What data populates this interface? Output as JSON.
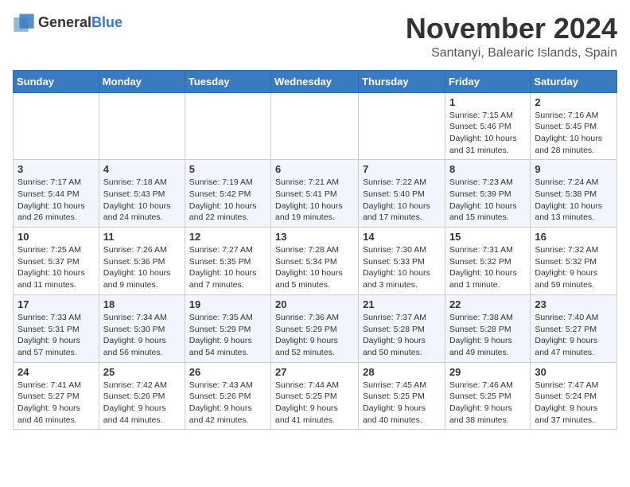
{
  "logo": {
    "general": "General",
    "blue": "Blue"
  },
  "header": {
    "month": "November 2024",
    "location": "Santanyi, Balearic Islands, Spain"
  },
  "weekdays": [
    "Sunday",
    "Monday",
    "Tuesday",
    "Wednesday",
    "Thursday",
    "Friday",
    "Saturday"
  ],
  "weeks": [
    [
      {
        "day": "",
        "info": ""
      },
      {
        "day": "",
        "info": ""
      },
      {
        "day": "",
        "info": ""
      },
      {
        "day": "",
        "info": ""
      },
      {
        "day": "",
        "info": ""
      },
      {
        "day": "1",
        "info": "Sunrise: 7:15 AM\nSunset: 5:46 PM\nDaylight: 10 hours and 31 minutes."
      },
      {
        "day": "2",
        "info": "Sunrise: 7:16 AM\nSunset: 5:45 PM\nDaylight: 10 hours and 28 minutes."
      }
    ],
    [
      {
        "day": "3",
        "info": "Sunrise: 7:17 AM\nSunset: 5:44 PM\nDaylight: 10 hours and 26 minutes."
      },
      {
        "day": "4",
        "info": "Sunrise: 7:18 AM\nSunset: 5:43 PM\nDaylight: 10 hours and 24 minutes."
      },
      {
        "day": "5",
        "info": "Sunrise: 7:19 AM\nSunset: 5:42 PM\nDaylight: 10 hours and 22 minutes."
      },
      {
        "day": "6",
        "info": "Sunrise: 7:21 AM\nSunset: 5:41 PM\nDaylight: 10 hours and 19 minutes."
      },
      {
        "day": "7",
        "info": "Sunrise: 7:22 AM\nSunset: 5:40 PM\nDaylight: 10 hours and 17 minutes."
      },
      {
        "day": "8",
        "info": "Sunrise: 7:23 AM\nSunset: 5:39 PM\nDaylight: 10 hours and 15 minutes."
      },
      {
        "day": "9",
        "info": "Sunrise: 7:24 AM\nSunset: 5:38 PM\nDaylight: 10 hours and 13 minutes."
      }
    ],
    [
      {
        "day": "10",
        "info": "Sunrise: 7:25 AM\nSunset: 5:37 PM\nDaylight: 10 hours and 11 minutes."
      },
      {
        "day": "11",
        "info": "Sunrise: 7:26 AM\nSunset: 5:36 PM\nDaylight: 10 hours and 9 minutes."
      },
      {
        "day": "12",
        "info": "Sunrise: 7:27 AM\nSunset: 5:35 PM\nDaylight: 10 hours and 7 minutes."
      },
      {
        "day": "13",
        "info": "Sunrise: 7:28 AM\nSunset: 5:34 PM\nDaylight: 10 hours and 5 minutes."
      },
      {
        "day": "14",
        "info": "Sunrise: 7:30 AM\nSunset: 5:33 PM\nDaylight: 10 hours and 3 minutes."
      },
      {
        "day": "15",
        "info": "Sunrise: 7:31 AM\nSunset: 5:32 PM\nDaylight: 10 hours and 1 minute."
      },
      {
        "day": "16",
        "info": "Sunrise: 7:32 AM\nSunset: 5:32 PM\nDaylight: 9 hours and 59 minutes."
      }
    ],
    [
      {
        "day": "17",
        "info": "Sunrise: 7:33 AM\nSunset: 5:31 PM\nDaylight: 9 hours and 57 minutes."
      },
      {
        "day": "18",
        "info": "Sunrise: 7:34 AM\nSunset: 5:30 PM\nDaylight: 9 hours and 56 minutes."
      },
      {
        "day": "19",
        "info": "Sunrise: 7:35 AM\nSunset: 5:29 PM\nDaylight: 9 hours and 54 minutes."
      },
      {
        "day": "20",
        "info": "Sunrise: 7:36 AM\nSunset: 5:29 PM\nDaylight: 9 hours and 52 minutes."
      },
      {
        "day": "21",
        "info": "Sunrise: 7:37 AM\nSunset: 5:28 PM\nDaylight: 9 hours and 50 minutes."
      },
      {
        "day": "22",
        "info": "Sunrise: 7:38 AM\nSunset: 5:28 PM\nDaylight: 9 hours and 49 minutes."
      },
      {
        "day": "23",
        "info": "Sunrise: 7:40 AM\nSunset: 5:27 PM\nDaylight: 9 hours and 47 minutes."
      }
    ],
    [
      {
        "day": "24",
        "info": "Sunrise: 7:41 AM\nSunset: 5:27 PM\nDaylight: 9 hours and 46 minutes."
      },
      {
        "day": "25",
        "info": "Sunrise: 7:42 AM\nSunset: 5:26 PM\nDaylight: 9 hours and 44 minutes."
      },
      {
        "day": "26",
        "info": "Sunrise: 7:43 AM\nSunset: 5:26 PM\nDaylight: 9 hours and 42 minutes."
      },
      {
        "day": "27",
        "info": "Sunrise: 7:44 AM\nSunset: 5:25 PM\nDaylight: 9 hours and 41 minutes."
      },
      {
        "day": "28",
        "info": "Sunrise: 7:45 AM\nSunset: 5:25 PM\nDaylight: 9 hours and 40 minutes."
      },
      {
        "day": "29",
        "info": "Sunrise: 7:46 AM\nSunset: 5:25 PM\nDaylight: 9 hours and 38 minutes."
      },
      {
        "day": "30",
        "info": "Sunrise: 7:47 AM\nSunset: 5:24 PM\nDaylight: 9 hours and 37 minutes."
      }
    ]
  ]
}
